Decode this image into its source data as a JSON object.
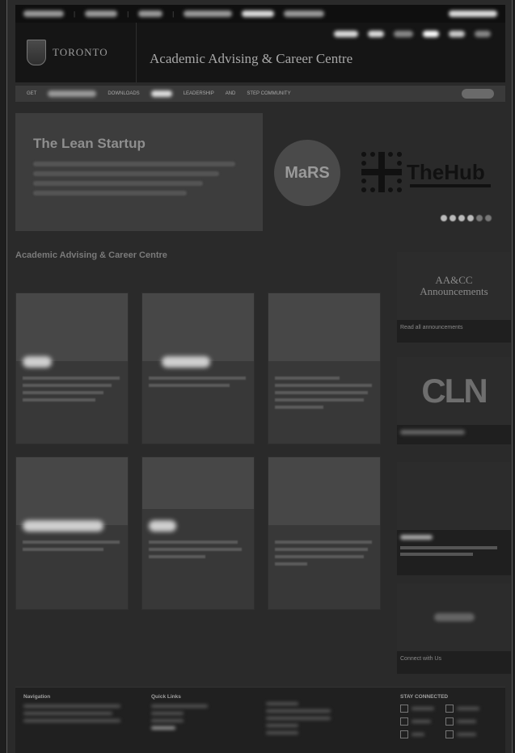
{
  "header": {
    "logo_text": "TORONTO",
    "site_title": "Academic Advising & Career Centre"
  },
  "nav": {
    "items": [
      "GET",
      "DOWNLOADS",
      "LEADERSHIP",
      "AND",
      "STEP COMMUNITY"
    ]
  },
  "hero": {
    "title": "The Lean Startup",
    "partners": [
      "MaRS",
      "TheHub"
    ]
  },
  "section": {
    "title": "Academic Advising & Career Centre"
  },
  "cards": [
    {
      "title": "",
      "text": ""
    },
    {
      "title": "",
      "text": ""
    },
    {
      "title": "",
      "text": ""
    },
    {
      "title": "",
      "text": ""
    },
    {
      "title": "",
      "text": ""
    },
    {
      "title": "",
      "text": "Read all AA&CC announcements"
    }
  ],
  "sidebar": {
    "items": [
      {
        "box_title": "AA&CC\nAnnouncements",
        "caption": "Read all announcements"
      },
      {
        "box_title": "CLN",
        "caption": ""
      },
      {
        "box_title": "",
        "caption": ""
      },
      {
        "box_title": "",
        "caption": "Connect with Us"
      }
    ]
  },
  "footer": {
    "col1_title": "Navigation",
    "col1_items": [
      "",
      "",
      ""
    ],
    "col2_title": "Quick Links",
    "col2_items": [
      "",
      "",
      "",
      ""
    ],
    "col3_items": [
      "",
      "",
      "",
      "",
      ""
    ],
    "col4_title": "STAY CONNECTED",
    "social": [
      "",
      "",
      "",
      "",
      "",
      ""
    ]
  },
  "colors": {
    "accent": "#9a9a9a",
    "background": "#2a2a2a"
  }
}
